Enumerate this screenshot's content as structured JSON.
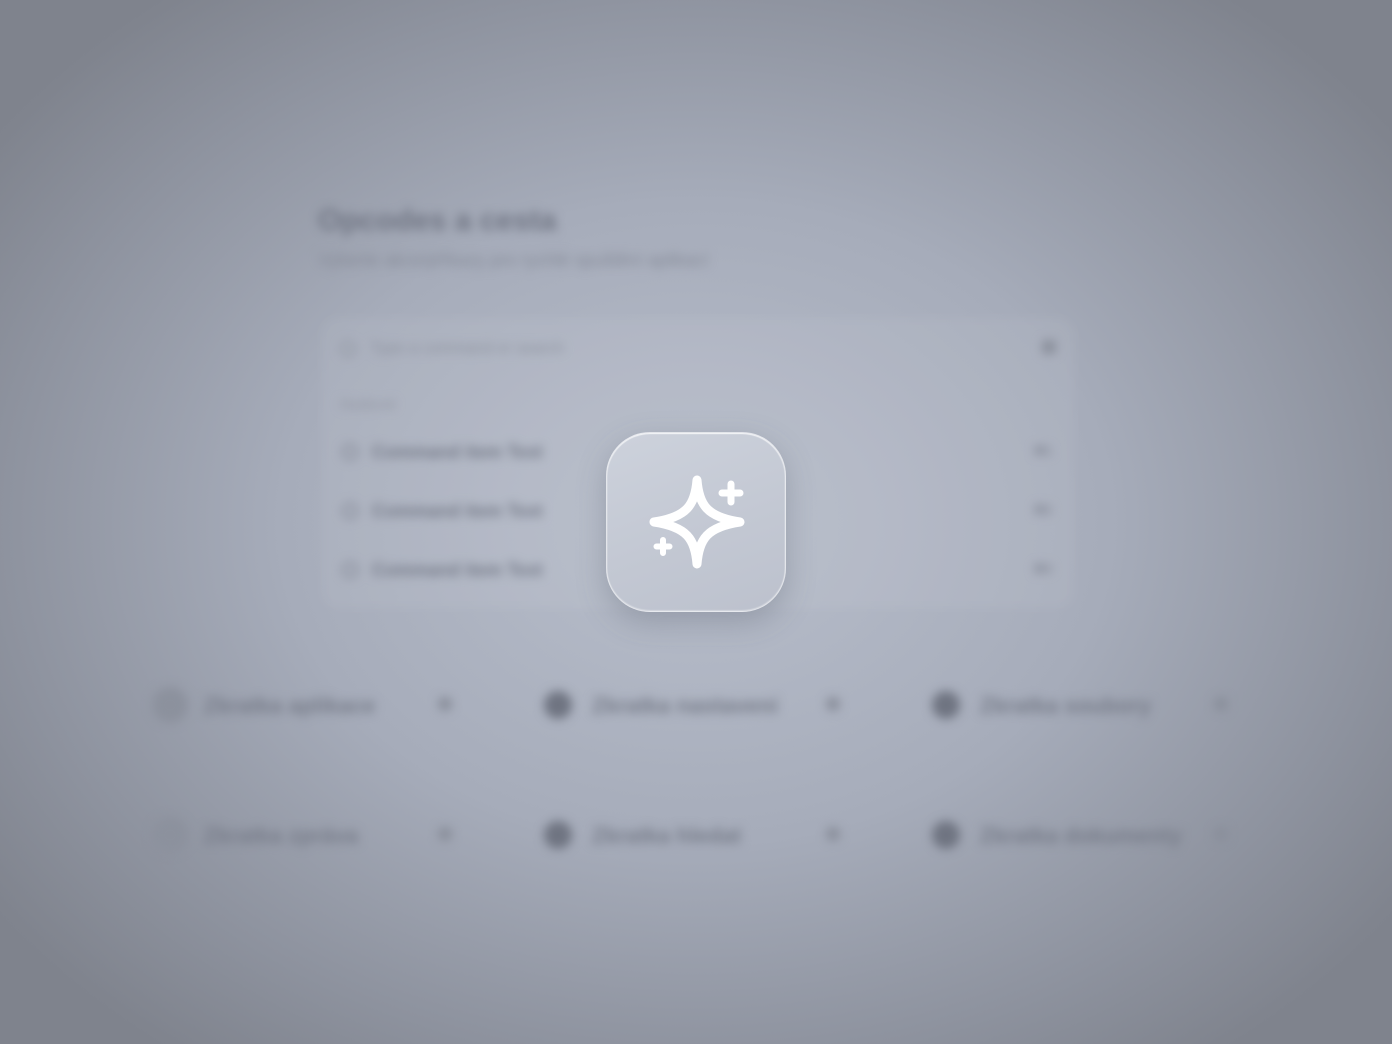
{
  "background": {
    "title": "Opcodes a cesta",
    "subtitle": "Vyberte akce/příkazy pro rychlé spuštění aplikací",
    "search": {
      "placeholder": "Type a command or search",
      "icon": "search-icon"
    },
    "section_label": "Nedávné",
    "list_items": [
      {
        "label": "Command item Text",
        "shortcut": "⌘1",
        "icon": "circle-icon"
      },
      {
        "label": "Command item Text",
        "shortcut": "⌘2",
        "icon": "circle-icon"
      },
      {
        "label": "Command item Text",
        "shortcut": "⌘3",
        "icon": "circle-icon"
      }
    ],
    "actions": [
      {
        "label": "Zkratka aplikace",
        "icon": "avatar-icon"
      },
      {
        "label": "Zkratka nastavení",
        "icon": "gear-icon"
      },
      {
        "label": "Zkratka soubory",
        "icon": "folder-icon"
      },
      {
        "label": "Zkratka zpráva",
        "icon": "message-icon"
      },
      {
        "label": "Zkratka hledat",
        "icon": "search-icon"
      },
      {
        "label": "Zkratka dokumenty",
        "icon": "document-icon"
      }
    ]
  },
  "foreground": {
    "icon": "sparkle-icon",
    "tile_color": "#c6cbd5",
    "glyph_color": "#ffffff"
  }
}
